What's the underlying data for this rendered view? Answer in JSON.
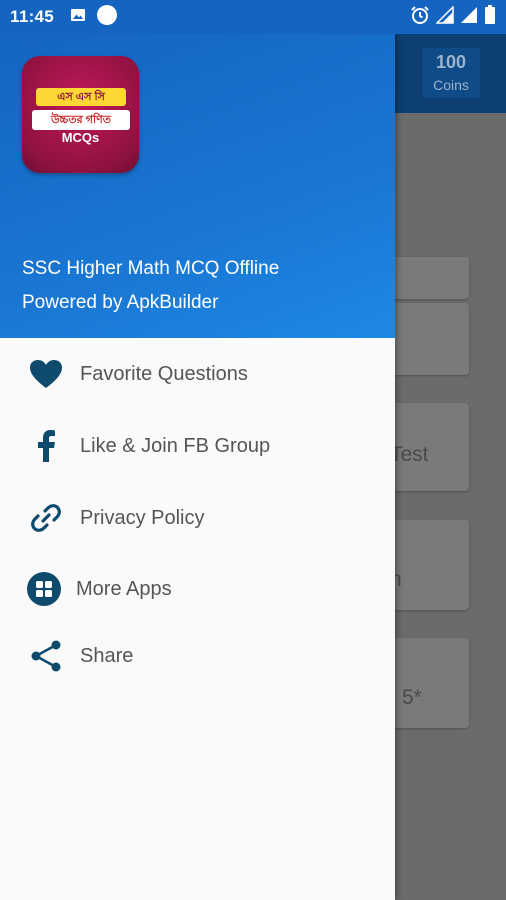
{
  "status_bar": {
    "time": "11:45",
    "icons": [
      "image-icon",
      "circle-icon",
      "alarm-icon",
      "signal-icon",
      "signal-icon",
      "battery-icon"
    ]
  },
  "background_app": {
    "coins_value": "100",
    "coins_label": "Coins",
    "card_texts": [
      "",
      "",
      "Test",
      "n",
      "5*"
    ]
  },
  "drawer": {
    "logo": {
      "line1": "এস এস সি",
      "line2": "উচ্চতর গণিত",
      "line3": "MCQs"
    },
    "title": "SSC Higher Math MCQ Offline",
    "subtitle": "Powered by ApkBuilder",
    "menu_items": [
      {
        "label": "Favorite Questions",
        "icon": "heart-icon"
      },
      {
        "label": "Like & Join FB Group",
        "icon": "facebook-icon"
      },
      {
        "label": "Privacy Policy",
        "icon": "link-icon"
      },
      {
        "label": "More Apps",
        "icon": "apps-grid-icon"
      },
      {
        "label": "Share",
        "icon": "share-icon"
      }
    ]
  },
  "colors": {
    "status_bar": "#1565c0",
    "drawer_header": "#1976d2",
    "icon": "#0d4a6b",
    "menu_text": "#555555"
  }
}
